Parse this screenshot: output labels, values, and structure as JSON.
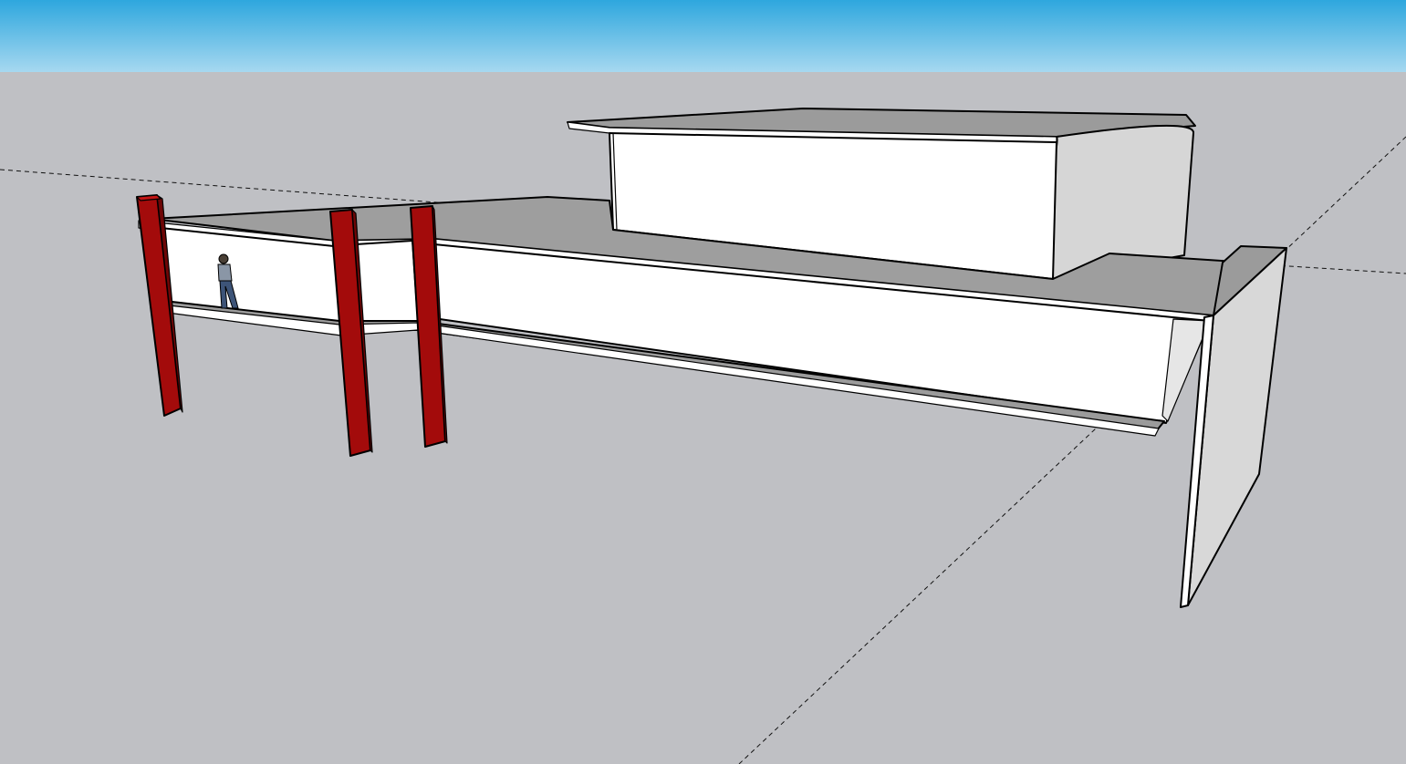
{
  "viewport": {
    "sky_top_color": "#2ea7de",
    "sky_bottom_color": "#a6d8f0",
    "ground_color": "#bfc0c4"
  },
  "model": {
    "column_color": "#a30b0b",
    "column_shade_color": "#6e0606",
    "surface_light": "#ffffff",
    "surface_mid": "#cfcfcf",
    "surface_dark": "#9b9b9b",
    "components": [
      "upper-volume",
      "lower-volume",
      "red-columns",
      "end-wall",
      "human-figure"
    ]
  },
  "axes": {
    "red_axis": "dashed",
    "green_axis": "dashed"
  }
}
